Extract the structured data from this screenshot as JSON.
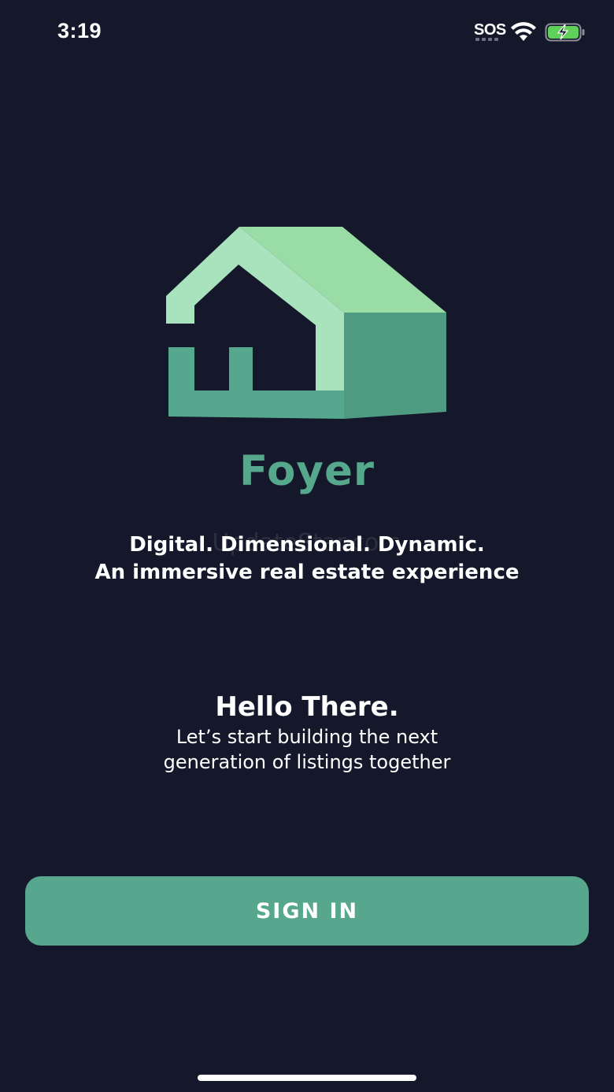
{
  "status_bar": {
    "time": "3:19",
    "sos": "SOS"
  },
  "brand": {
    "name": "Foyer",
    "logo_icon": "house-logo-icon"
  },
  "tagline": {
    "line1": "Digital. Dimensional. Dynamic.",
    "line2": "An immersive real estate experience"
  },
  "watermark": "UpdateStar.com",
  "hello": {
    "title": "Hello There.",
    "line1": "Let’s start building the next",
    "line2": "generation of listings together"
  },
  "sign_in": {
    "label": "SIGN IN"
  },
  "colors": {
    "background": "#15182a",
    "accent": "#56a78e",
    "logo_light": "#a9e3bd",
    "logo_dark": "#4e9b82"
  }
}
